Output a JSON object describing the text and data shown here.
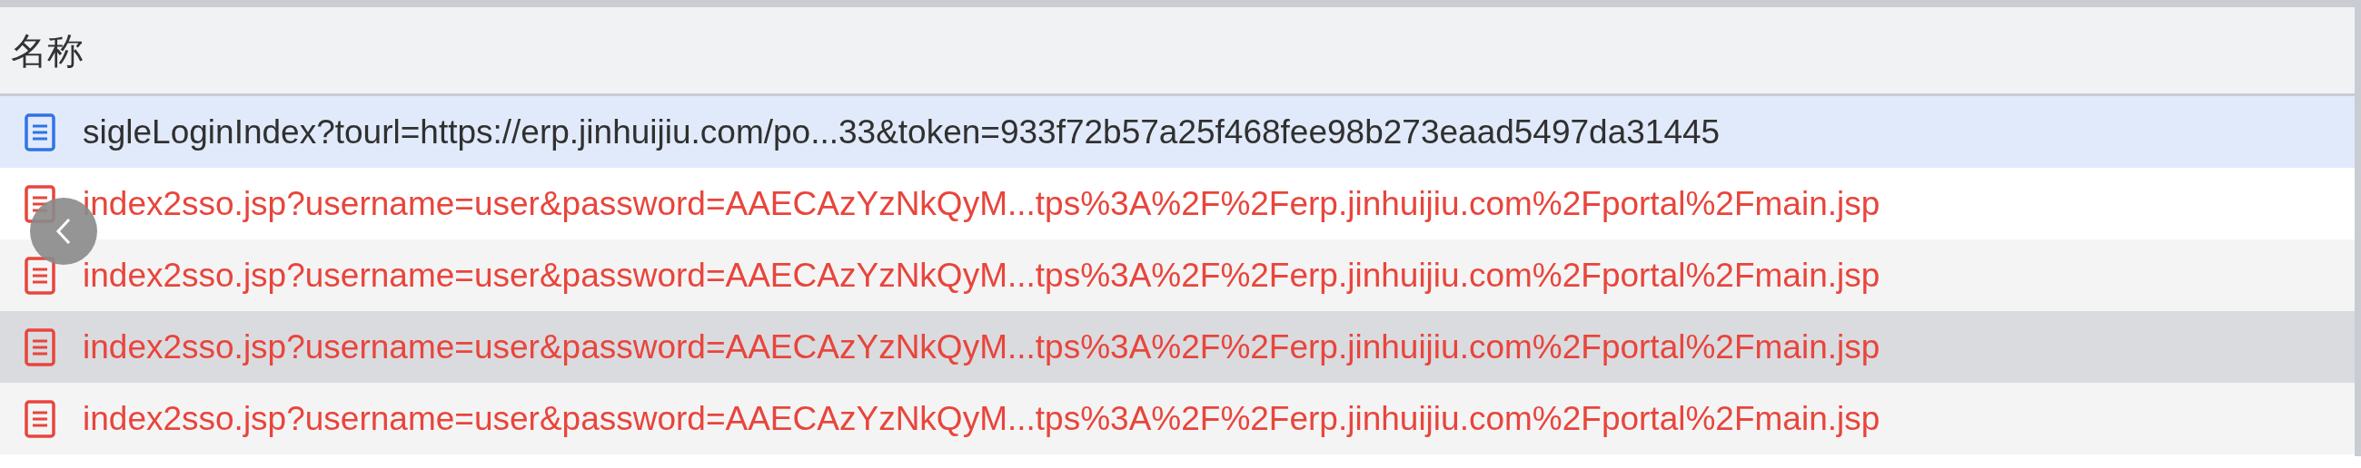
{
  "column_header": "名称",
  "rows": [
    {
      "name": "sigleLoginIndex?tourl=https://erp.jinhuijiu.com/po...33&token=933f72b57a25f468fee98b273eaad5497da31445",
      "kind": "ok",
      "selected": true,
      "hovered": false
    },
    {
      "name": "index2sso.jsp?username=user&password=AAECAzYzNkQyM...tps%3A%2F%2Ferp.jinhuijiu.com%2Fportal%2Fmain.jsp",
      "kind": "error",
      "selected": false,
      "hovered": false
    },
    {
      "name": "index2sso.jsp?username=user&password=AAECAzYzNkQyM...tps%3A%2F%2Ferp.jinhuijiu.com%2Fportal%2Fmain.jsp",
      "kind": "error",
      "selected": false,
      "hovered": false
    },
    {
      "name": "index2sso.jsp?username=user&password=AAECAzYzNkQyM...tps%3A%2F%2Ferp.jinhuijiu.com%2Fportal%2Fmain.jsp",
      "kind": "error",
      "selected": false,
      "hovered": true
    },
    {
      "name": "index2sso.jsp?username=user&password=AAECAzYzNkQyM...tps%3A%2F%2Ferp.jinhuijiu.com%2Fportal%2Fmain.jsp",
      "kind": "error",
      "selected": false,
      "hovered": false
    }
  ]
}
